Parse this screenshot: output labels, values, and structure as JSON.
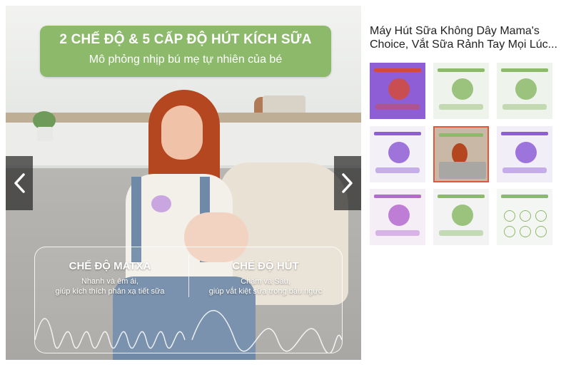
{
  "banner": {
    "title": "2 CHẾ ĐỘ & 5 CẤP ĐỘ HÚT KÍCH SỮA",
    "subtitle": "Mô phỏng nhịp bú mẹ tự nhiên của bé"
  },
  "modes": [
    {
      "title": "CHẾ ĐỘ MATXA",
      "line1": "Nhanh và êm ái,",
      "line2": "giúp kích thích phản xạ tiết sữa"
    },
    {
      "title": "CHẾ ĐỘ HÚT",
      "line1": "Chậm và Sâu,",
      "line2": "giúp vắt kiệt sữa trong bầu ngực"
    }
  ],
  "nav": {
    "prev_icon": "chevron-left-icon",
    "next_icon": "chevron-right-icon"
  },
  "product": {
    "title": "Máy Hút Sữa Không Dây Mama's Choice, Vắt Sữa Rảnh Tay Mọi Lúc..."
  },
  "thumbnails": {
    "selected_index": 4,
    "items": [
      {
        "theme": "#8e5ed6",
        "accent": "#d44b3a",
        "kind": "product"
      },
      {
        "theme": "#eef3ec",
        "accent": "#8cba6a",
        "kind": "product"
      },
      {
        "theme": "#eef3ec",
        "accent": "#8cba6a",
        "kind": "product"
      },
      {
        "theme": "#f4f0f8",
        "accent": "#8e5ed6",
        "kind": "product"
      },
      {
        "theme": "#c9b8a6",
        "accent": "#8cba6a",
        "kind": "photo"
      },
      {
        "theme": "#f2eef8",
        "accent": "#8e5ed6",
        "kind": "product"
      },
      {
        "theme": "#f6eef6",
        "accent": "#b46ad0",
        "kind": "product"
      },
      {
        "theme": "#f2f3f2",
        "accent": "#8cba6a",
        "kind": "product"
      },
      {
        "theme": "#f4f6f3",
        "accent": "#8cba6a",
        "kind": "icons"
      }
    ]
  }
}
